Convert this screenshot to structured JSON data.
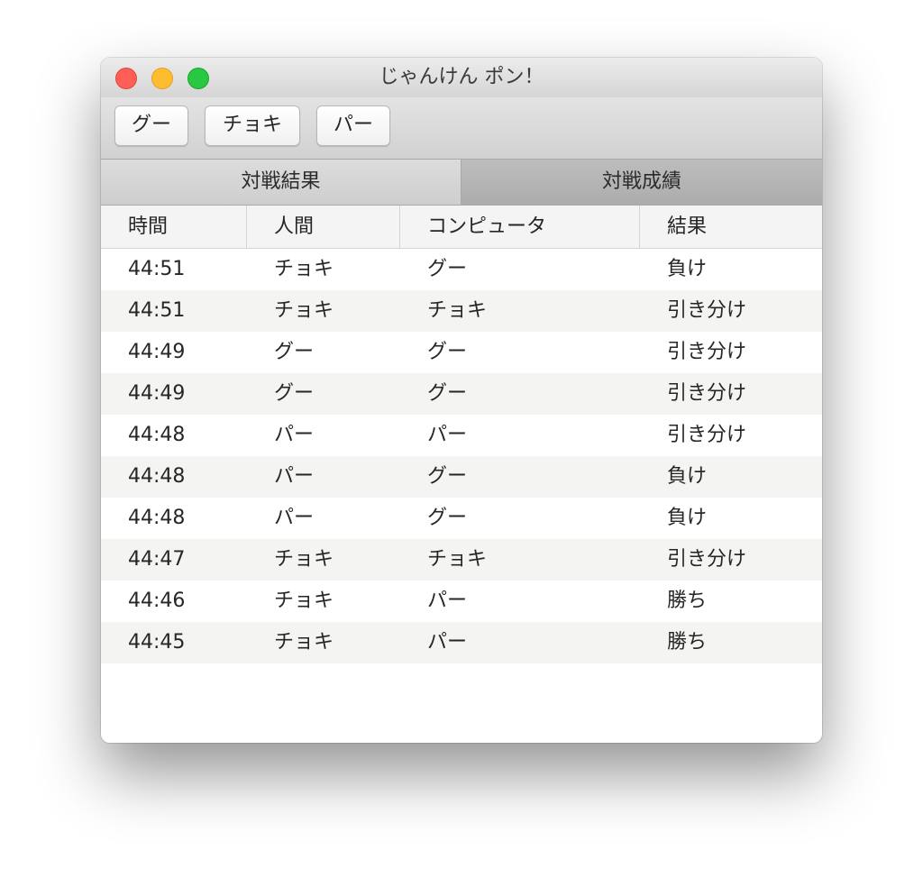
{
  "window": {
    "title": "じゃんけん ポン！"
  },
  "toolbar": {
    "buttons": [
      {
        "label": "グー"
      },
      {
        "label": "チョキ"
      },
      {
        "label": "パー"
      }
    ]
  },
  "tabs": [
    {
      "label": "対戦結果",
      "selected": true
    },
    {
      "label": "対戦成績",
      "selected": false
    }
  ],
  "table": {
    "columns": [
      "時間",
      "人間",
      "コンピュータ",
      "結果"
    ],
    "rows": [
      [
        "44:51",
        "チョキ",
        "グー",
        "負け"
      ],
      [
        "44:51",
        "チョキ",
        "チョキ",
        "引き分け"
      ],
      [
        "44:49",
        "グー",
        "グー",
        "引き分け"
      ],
      [
        "44:49",
        "グー",
        "グー",
        "引き分け"
      ],
      [
        "44:48",
        "パー",
        "パー",
        "引き分け"
      ],
      [
        "44:48",
        "パー",
        "グー",
        "負け"
      ],
      [
        "44:48",
        "パー",
        "グー",
        "負け"
      ],
      [
        "44:47",
        "チョキ",
        "チョキ",
        "引き分け"
      ],
      [
        "44:46",
        "チョキ",
        "パー",
        "勝ち"
      ],
      [
        "44:45",
        "チョキ",
        "パー",
        "勝ち"
      ]
    ]
  },
  "colors": {
    "close": "#fd5f57",
    "minimize": "#febc2e",
    "zoom": "#28c840",
    "row_alt": "#f4f4f3"
  }
}
